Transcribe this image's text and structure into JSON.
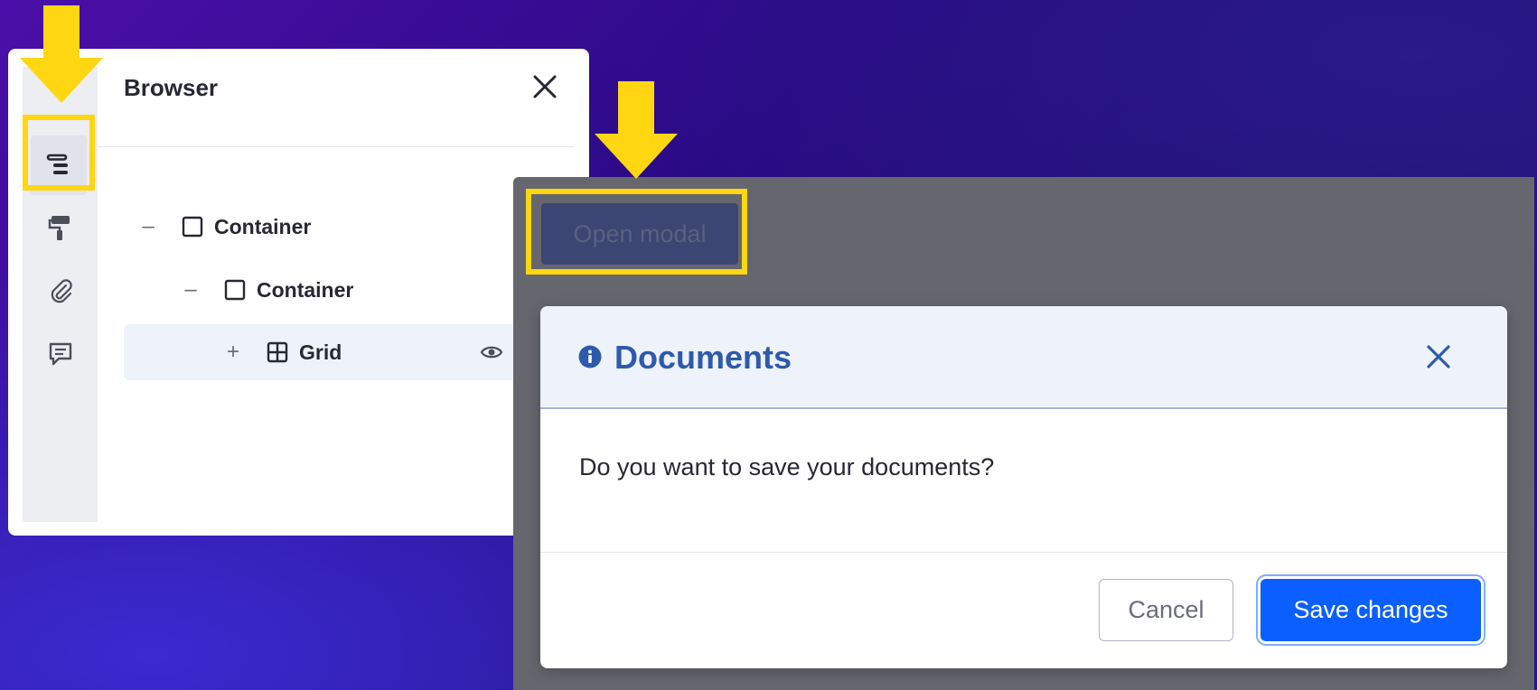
{
  "browser_panel": {
    "title": "Browser",
    "rail": [
      {
        "name": "browser-icon",
        "active": true
      },
      {
        "name": "paint-roller-icon",
        "active": false
      },
      {
        "name": "paperclip-icon",
        "active": false
      },
      {
        "name": "comment-icon",
        "active": false
      }
    ],
    "tree": [
      {
        "toggle": "–",
        "icon": "square-icon",
        "label": "Container",
        "depth": 0
      },
      {
        "toggle": "–",
        "icon": "square-icon",
        "label": "Container",
        "depth": 1
      },
      {
        "toggle": "+",
        "icon": "grid-icon",
        "label": "Grid",
        "depth": 2,
        "selected": true,
        "visible_icon": "eye-icon"
      }
    ]
  },
  "preview": {
    "open_modal_label": "Open modal"
  },
  "modal": {
    "title": "Documents",
    "title_icon": "info-circle-icon",
    "body": "Do you want to save your documents?",
    "cancel_label": "Cancel",
    "save_label": "Save changes"
  },
  "colors": {
    "highlight": "#ffd612",
    "primary": "#0b5fff",
    "modal_title": "#2e5aac"
  }
}
